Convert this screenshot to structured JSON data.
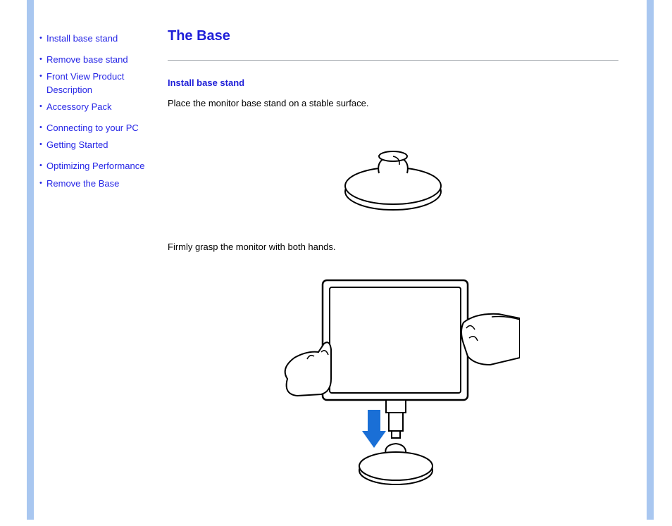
{
  "sidebar": {
    "groups": [
      {
        "items": [
          {
            "label": "Install base stand"
          }
        ]
      },
      {
        "items": [
          {
            "label": "Remove base stand"
          },
          {
            "label": "Front View Product Description"
          },
          {
            "label": "Accessory Pack"
          }
        ]
      },
      {
        "items": [
          {
            "label": "Connecting to your PC"
          },
          {
            "label": "Getting Started"
          }
        ]
      },
      {
        "items": [
          {
            "label": "Optimizing Performance"
          },
          {
            "label": "Remove the Base"
          }
        ]
      }
    ]
  },
  "content": {
    "title": "The Base",
    "section_heading": "Install base stand",
    "step1_text": "Place the monitor base stand on a stable surface.",
    "step2_text": "Firmly grasp the monitor with both hands."
  },
  "colors": {
    "link": "#2626e6",
    "accent_bar": "#a9c7f0",
    "arrow": "#1a6fd6"
  }
}
